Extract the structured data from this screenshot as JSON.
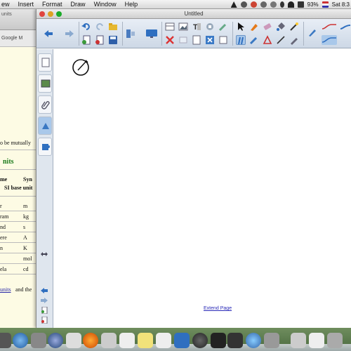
{
  "menubar": {
    "items": [
      "ew",
      "Insert",
      "Format",
      "Draw",
      "Window",
      "Help"
    ],
    "battery": "93%",
    "clock": "Sat 8:3"
  },
  "browser": {
    "tab_text": "units",
    "tab2_text": "Google M",
    "line_mutually": "o be mutually",
    "heading": "nits",
    "col_name": "me",
    "col_sym": "Syn",
    "col_sub": "SI base unit",
    "rows": [
      {
        "name": "r",
        "sym": "m"
      },
      {
        "name": "ram",
        "sym": "kg"
      },
      {
        "name": "nd",
        "sym": "s"
      },
      {
        "name": "ere",
        "sym": "A"
      },
      {
        "name": "n",
        "sym": "K"
      },
      {
        "name": "",
        "sym": "mol"
      },
      {
        "name": "ela",
        "sym": "cd"
      }
    ],
    "footer_link": "units",
    "footer_text": " and the"
  },
  "notebook": {
    "title": "Untitled",
    "extend_page": "Extend Page"
  },
  "colors": {
    "accent": "#3a78c2",
    "link": "#2a2ab8",
    "heading_green": "#1a7a1a"
  }
}
